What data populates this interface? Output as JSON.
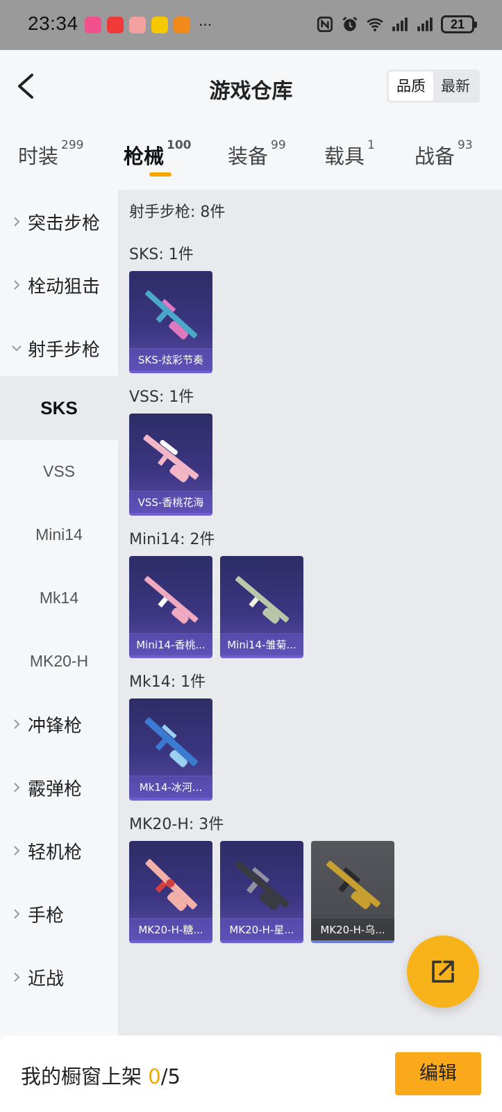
{
  "status_bar": {
    "time": "23:34",
    "more": "···",
    "battery": "21",
    "apps": [
      {
        "name": "app-icon-pink",
        "color": "#f0508c"
      },
      {
        "name": "app-icon-red",
        "color": "#f03a3a"
      },
      {
        "name": "app-icon-pig",
        "color": "#f5a0a0"
      },
      {
        "name": "app-icon-seven",
        "color": "#f5c800"
      },
      {
        "name": "app-icon-orange",
        "color": "#f28a1a"
      }
    ]
  },
  "header": {
    "title": "游戏仓库",
    "sort_options": [
      "品质",
      "最新"
    ]
  },
  "tabs": [
    {
      "label": "时装",
      "count": "299"
    },
    {
      "label": "枪械",
      "count": "100"
    },
    {
      "label": "装备",
      "count": "99"
    },
    {
      "label": "载具",
      "count": "1"
    },
    {
      "label": "战备",
      "count": "93"
    }
  ],
  "sidebar": {
    "items": [
      {
        "label": "突击步枪",
        "type": "category",
        "expanded": false
      },
      {
        "label": "栓动狙击",
        "type": "category",
        "expanded": false
      },
      {
        "label": "射手步枪",
        "type": "category",
        "expanded": true
      },
      {
        "label": "SKS",
        "type": "sub",
        "selected": true
      },
      {
        "label": "VSS",
        "type": "sub"
      },
      {
        "label": "Mini14",
        "type": "sub"
      },
      {
        "label": "Mk14",
        "type": "sub"
      },
      {
        "label": "MK20-H",
        "type": "sub"
      },
      {
        "label": "冲锋枪",
        "type": "category",
        "expanded": false
      },
      {
        "label": "霰弹枪",
        "type": "category",
        "expanded": false
      },
      {
        "label": "轻机枪",
        "type": "category",
        "expanded": false
      },
      {
        "label": "手枪",
        "type": "category",
        "expanded": false
      },
      {
        "label": "近战",
        "type": "category",
        "expanded": false
      }
    ]
  },
  "content": {
    "section_title": "射手步枪: 8件",
    "groups": [
      {
        "title": "SKS: 1件",
        "items": [
          {
            "label": "SKS-炫彩节奏",
            "gun_color": "#4aa8c8",
            "accent": "#e07ac0"
          }
        ]
      },
      {
        "title": "VSS: 1件",
        "items": [
          {
            "label": "VSS-香桃花海",
            "gun_color": "#f2b6c6",
            "accent": "#ffffff"
          }
        ]
      },
      {
        "title": "Mini14: 2件",
        "items": [
          {
            "label": "Mini14-香桃...",
            "gun_color": "#f0aac0",
            "accent": "#ffffff"
          },
          {
            "label": "Mini14-雏菊...",
            "gun_color": "#b8c8a8",
            "accent": "#f0f0e0"
          }
        ]
      },
      {
        "title": "Mk14: 1件",
        "items": [
          {
            "label": "Mk14-冰河...",
            "gun_color": "#3a7ad0",
            "accent": "#9ad0f0"
          }
        ]
      },
      {
        "title": "MK20-H: 3件",
        "items": [
          {
            "label": "MK20-H-糖...",
            "gun_color": "#f2b0a8",
            "accent": "#d04040"
          },
          {
            "label": "MK20-H-星...",
            "gun_color": "#3a3a42",
            "accent": "#9090a0"
          },
          {
            "label": "MK20-H-乌...",
            "gun_color": "#c8a030",
            "accent": "#2a2a2a",
            "grey": true
          }
        ]
      }
    ]
  },
  "bottom_bar": {
    "label": "我的橱窗上架",
    "current": "0",
    "total": "/5",
    "edit_label": "编辑"
  },
  "colors": {
    "accent": "#f9a91a",
    "card_purple": "#3b3580",
    "underline": "#f5a700"
  }
}
